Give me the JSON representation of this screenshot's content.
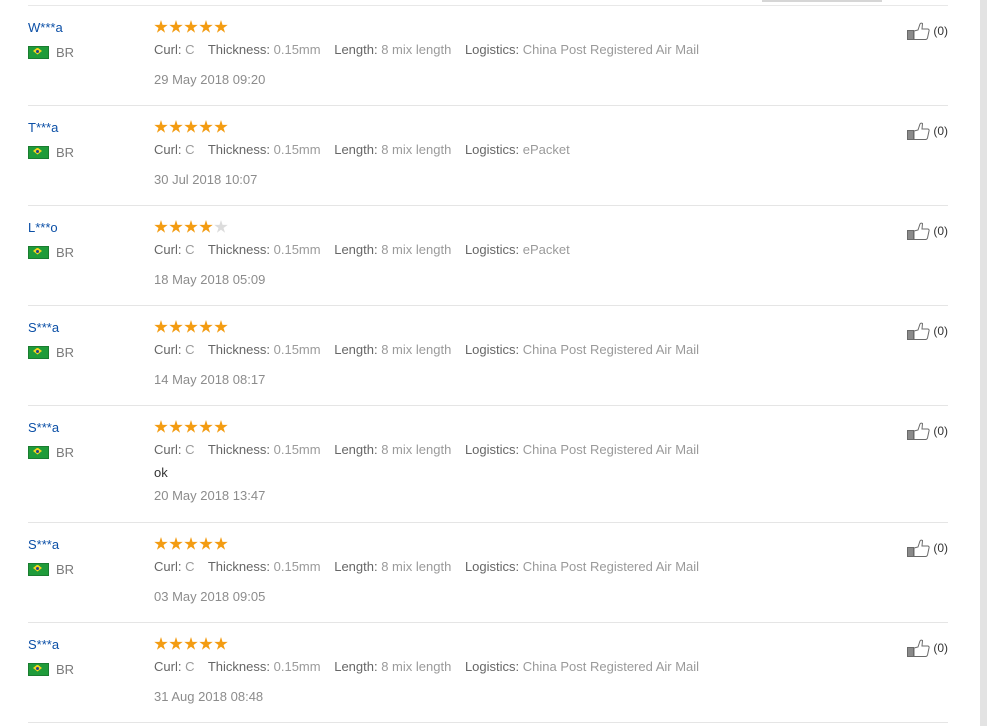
{
  "reviews": [
    {
      "name": "W***a",
      "country": "BR",
      "rating": 5,
      "attrs": {
        "curl_label": "Curl:",
        "curl": "C",
        "thickness_label": "Thickness:",
        "thickness": "0.15mm",
        "length_label": "Length:",
        "length": "8 mix length",
        "logistics_label": "Logistics:",
        "logistics": "China Post Registered Air Mail"
      },
      "comment": "",
      "date": "29 May 2018 09:20",
      "helpful": "(0)"
    },
    {
      "name": "T***a",
      "country": "BR",
      "rating": 5,
      "attrs": {
        "curl_label": "Curl:",
        "curl": "C",
        "thickness_label": "Thickness:",
        "thickness": "0.15mm",
        "length_label": "Length:",
        "length": "8 mix length",
        "logistics_label": "Logistics:",
        "logistics": "ePacket"
      },
      "comment": "",
      "date": "30 Jul 2018 10:07",
      "helpful": "(0)"
    },
    {
      "name": "L***o",
      "country": "BR",
      "rating": 4,
      "attrs": {
        "curl_label": "Curl:",
        "curl": "C",
        "thickness_label": "Thickness:",
        "thickness": "0.15mm",
        "length_label": "Length:",
        "length": "8 mix length",
        "logistics_label": "Logistics:",
        "logistics": "ePacket"
      },
      "comment": "",
      "date": "18 May 2018 05:09",
      "helpful": "(0)"
    },
    {
      "name": "S***a",
      "country": "BR",
      "rating": 5,
      "attrs": {
        "curl_label": "Curl:",
        "curl": "C",
        "thickness_label": "Thickness:",
        "thickness": "0.15mm",
        "length_label": "Length:",
        "length": "8 mix length",
        "logistics_label": "Logistics:",
        "logistics": "China Post Registered Air Mail"
      },
      "comment": "",
      "date": "14 May 2018 08:17",
      "helpful": "(0)"
    },
    {
      "name": "S***a",
      "country": "BR",
      "rating": 5,
      "attrs": {
        "curl_label": "Curl:",
        "curl": "C",
        "thickness_label": "Thickness:",
        "thickness": "0.15mm",
        "length_label": "Length:",
        "length": "8 mix length",
        "logistics_label": "Logistics:",
        "logistics": "China Post Registered Air Mail"
      },
      "comment": "ok",
      "date": "20 May 2018 13:47",
      "helpful": "(0)"
    },
    {
      "name": "S***a",
      "country": "BR",
      "rating": 5,
      "attrs": {
        "curl_label": "Curl:",
        "curl": "C",
        "thickness_label": "Thickness:",
        "thickness": "0.15mm",
        "length_label": "Length:",
        "length": "8 mix length",
        "logistics_label": "Logistics:",
        "logistics": "China Post Registered Air Mail"
      },
      "comment": "",
      "date": "03 May 2018 09:05",
      "helpful": "(0)"
    },
    {
      "name": "S***a",
      "country": "BR",
      "rating": 5,
      "attrs": {
        "curl_label": "Curl:",
        "curl": "C",
        "thickness_label": "Thickness:",
        "thickness": "0.15mm",
        "length_label": "Length:",
        "length": "8 mix length",
        "logistics_label": "Logistics:",
        "logistics": "China Post Registered Air Mail"
      },
      "comment": "",
      "date": "31 Aug 2018 08:48",
      "helpful": "(0)"
    }
  ]
}
